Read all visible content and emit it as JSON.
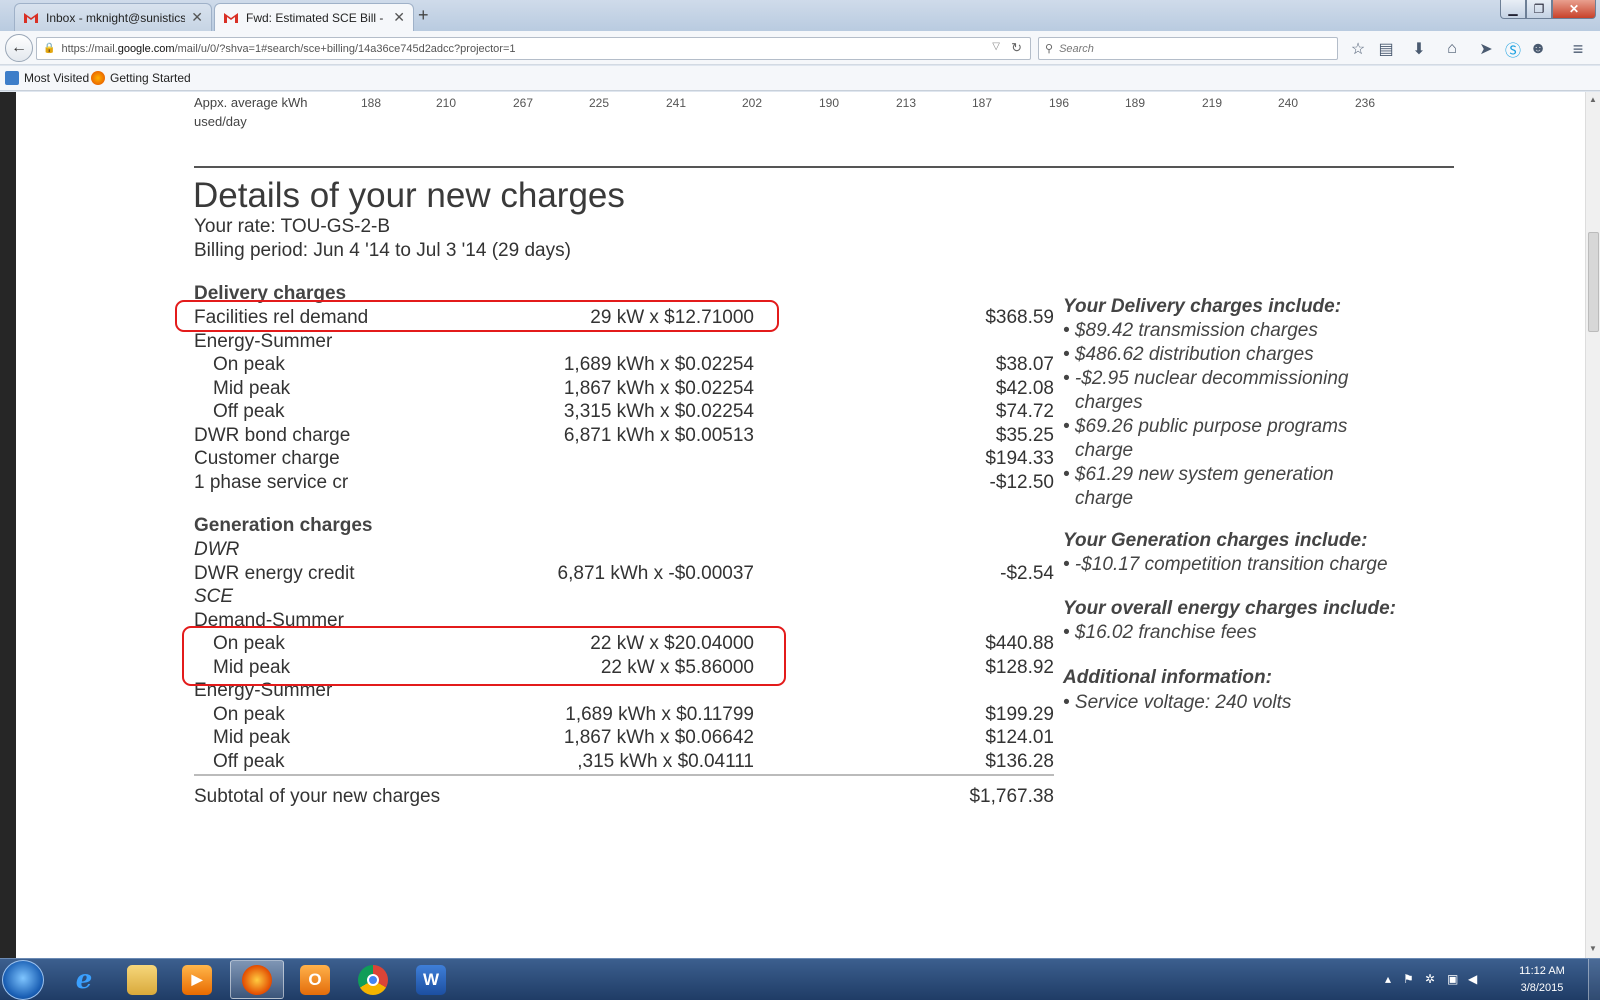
{
  "browser": {
    "tabs": [
      {
        "label": "Inbox - mknight@sunistics...",
        "active": false
      },
      {
        "label": "Fwd: Estimated SCE Bill - ...",
        "active": true
      }
    ],
    "url_prefix": "https://mail.",
    "url_host": "google.com",
    "url_rest": "/mail/u/0/?shva=1#search/sce+billing/14a36ce745d2adcc?projector=1",
    "search_placeholder": "Search",
    "bookmarks": [
      "Most Visited",
      "Getting Started"
    ],
    "nav_icons": [
      "star-icon",
      "reading-list-icon",
      "download-icon",
      "home-icon",
      "send-icon",
      "skype-icon",
      "chat-icon",
      "menu-icon"
    ]
  },
  "bill": {
    "avg_label_1": "Appx. average kWh",
    "avg_label_2": "used/day",
    "avg_values": [
      "188",
      "210",
      "267",
      "225",
      "241",
      "202",
      "190",
      "213",
      "187",
      "196",
      "189",
      "219",
      "240",
      "236"
    ],
    "title": "Details of your new charges",
    "rate": "Your rate: TOU-GS-2-B",
    "period": "Billing period: Jun 4 '14 to Jul 3 '14 (29 days)",
    "delivery_heading": "Delivery charges",
    "delivery": [
      {
        "label": "Facilities rel demand",
        "calc": "29 kW x $12.71000",
        "amount": "$368.59",
        "indent": false
      },
      {
        "label": "Energy-Summer",
        "calc": "",
        "amount": "",
        "indent": false
      },
      {
        "label": "On peak",
        "calc": "1,689 kWh x $0.02254",
        "amount": "$38.07",
        "indent": true
      },
      {
        "label": "Mid peak",
        "calc": "1,867 kWh x $0.02254",
        "amount": "$42.08",
        "indent": true
      },
      {
        "label": "Off peak",
        "calc": "3,315 kWh x $0.02254",
        "amount": "$74.72",
        "indent": true
      },
      {
        "label": "DWR bond charge",
        "calc": "6,871 kWh x $0.00513",
        "amount": "$35.25",
        "indent": false
      },
      {
        "label": "Customer charge",
        "calc": "",
        "amount": "$194.33",
        "indent": false
      },
      {
        "label": "1 phase service cr",
        "calc": "",
        "amount": "-$12.50",
        "indent": false
      }
    ],
    "generation_heading": "Generation charges",
    "generation": [
      {
        "label": "DWR",
        "calc": "",
        "amount": "",
        "indent": false,
        "italic": true
      },
      {
        "label": "DWR energy credit",
        "calc": "6,871 kWh x -$0.00037",
        "amount": "-$2.54",
        "indent": false
      },
      {
        "label": "SCE",
        "calc": "",
        "amount": "",
        "indent": false,
        "italic": true
      },
      {
        "label": "Demand-Summer",
        "calc": "",
        "amount": "",
        "indent": false
      },
      {
        "label": "On peak",
        "calc": "22 kW x $20.04000",
        "amount": "$440.88",
        "indent": true
      },
      {
        "label": "Mid peak",
        "calc": "22 kW x $5.86000",
        "amount": "$128.92",
        "indent": true
      },
      {
        "label": "Energy-Summer",
        "calc": "",
        "amount": "",
        "indent": false
      },
      {
        "label": "On peak",
        "calc": "1,689 kWh x $0.11799",
        "amount": "$199.29",
        "indent": true
      },
      {
        "label": "Mid peak",
        "calc": "1,867 kWh x $0.06642",
        "amount": "$124.01",
        "indent": true
      },
      {
        "label": "Off peak",
        "calc": ",315 kWh x $0.04111",
        "amount": "$136.28",
        "indent": true
      }
    ],
    "subtotal_label": "Subtotal of your new charges",
    "subtotal_amount": "$1,767.38",
    "side": {
      "delivery_heading": "Your Delivery charges include:",
      "delivery_items": [
        "• $89.42 transmission charges",
        "• $486.62 distribution charges",
        "• -$2.95 nuclear decommissioning",
        "charges",
        "• $69.26 public purpose programs",
        "charge",
        "• $61.29 new system generation",
        "charge"
      ],
      "generation_heading": "Your Generation charges include:",
      "generation_items": [
        "• -$10.17 competition transition charge"
      ],
      "overall_heading": "Your overall energy charges include:",
      "overall_items": [
        "• $16.02 franchise fees"
      ],
      "additional_heading": "Additional information:",
      "additional_items": [
        "• Service voltage: 240 volts"
      ]
    }
  },
  "taskbar": {
    "apps": [
      "internet-explorer",
      "file-explorer",
      "media-player",
      "firefox",
      "outlook",
      "chrome",
      "word"
    ],
    "time": "11:12 AM",
    "date": "3/8/2015"
  },
  "colors": {
    "highlight": "#e31b1b",
    "taskbar": "#2a4a78"
  }
}
